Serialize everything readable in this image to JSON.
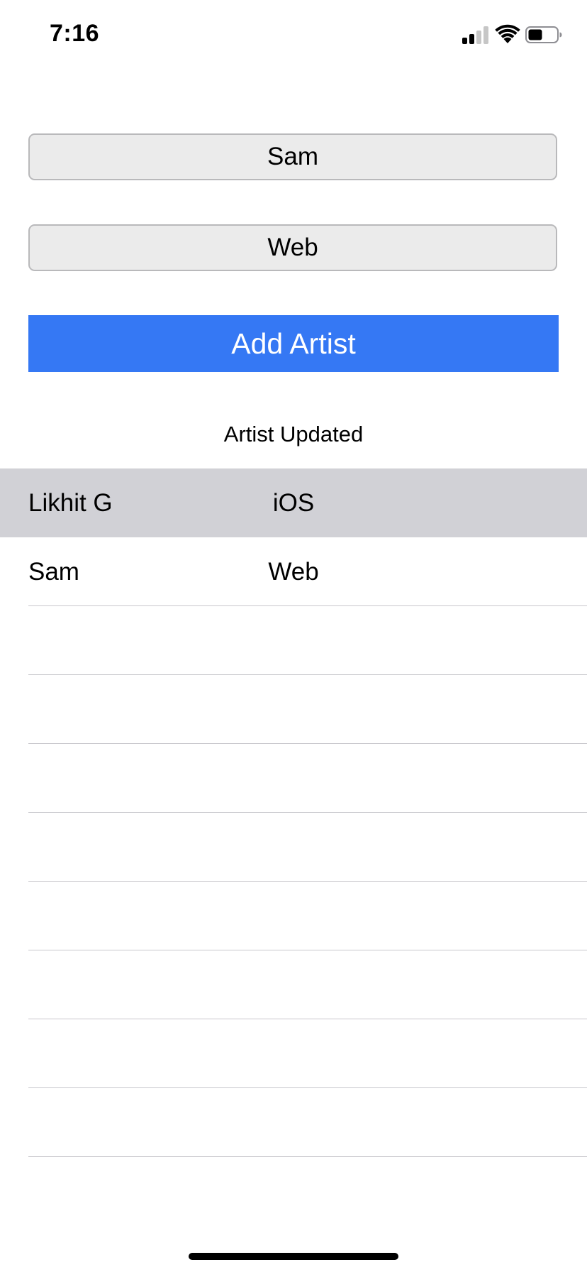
{
  "status_bar": {
    "time": "7:16",
    "signal_icon": "cellular-signal-icon",
    "wifi_icon": "wifi-icon",
    "battery_icon": "battery-icon",
    "signal_bars_active": 2,
    "battery_level": 0.5
  },
  "form": {
    "name_value": "Sam",
    "type_value": "Web",
    "add_button_label": "Add Artist",
    "status_message": "Artist Updated"
  },
  "table": {
    "rows": [
      {
        "name": "Likhit G",
        "type": "iOS",
        "selected": true
      },
      {
        "name": "Sam",
        "type": "Web",
        "selected": false
      },
      {
        "name": "",
        "type": "",
        "selected": false
      },
      {
        "name": "",
        "type": "",
        "selected": false
      },
      {
        "name": "",
        "type": "",
        "selected": false
      },
      {
        "name": "",
        "type": "",
        "selected": false
      },
      {
        "name": "",
        "type": "",
        "selected": false
      },
      {
        "name": "",
        "type": "",
        "selected": false
      },
      {
        "name": "",
        "type": "",
        "selected": false
      },
      {
        "name": "",
        "type": "",
        "selected": false
      }
    ]
  },
  "colors": {
    "accent": "#3578f4",
    "selected_row": "#d1d1d6",
    "field_background": "#ebebeb",
    "field_border": "#b9b9bb",
    "separator": "#c8c7cc"
  }
}
